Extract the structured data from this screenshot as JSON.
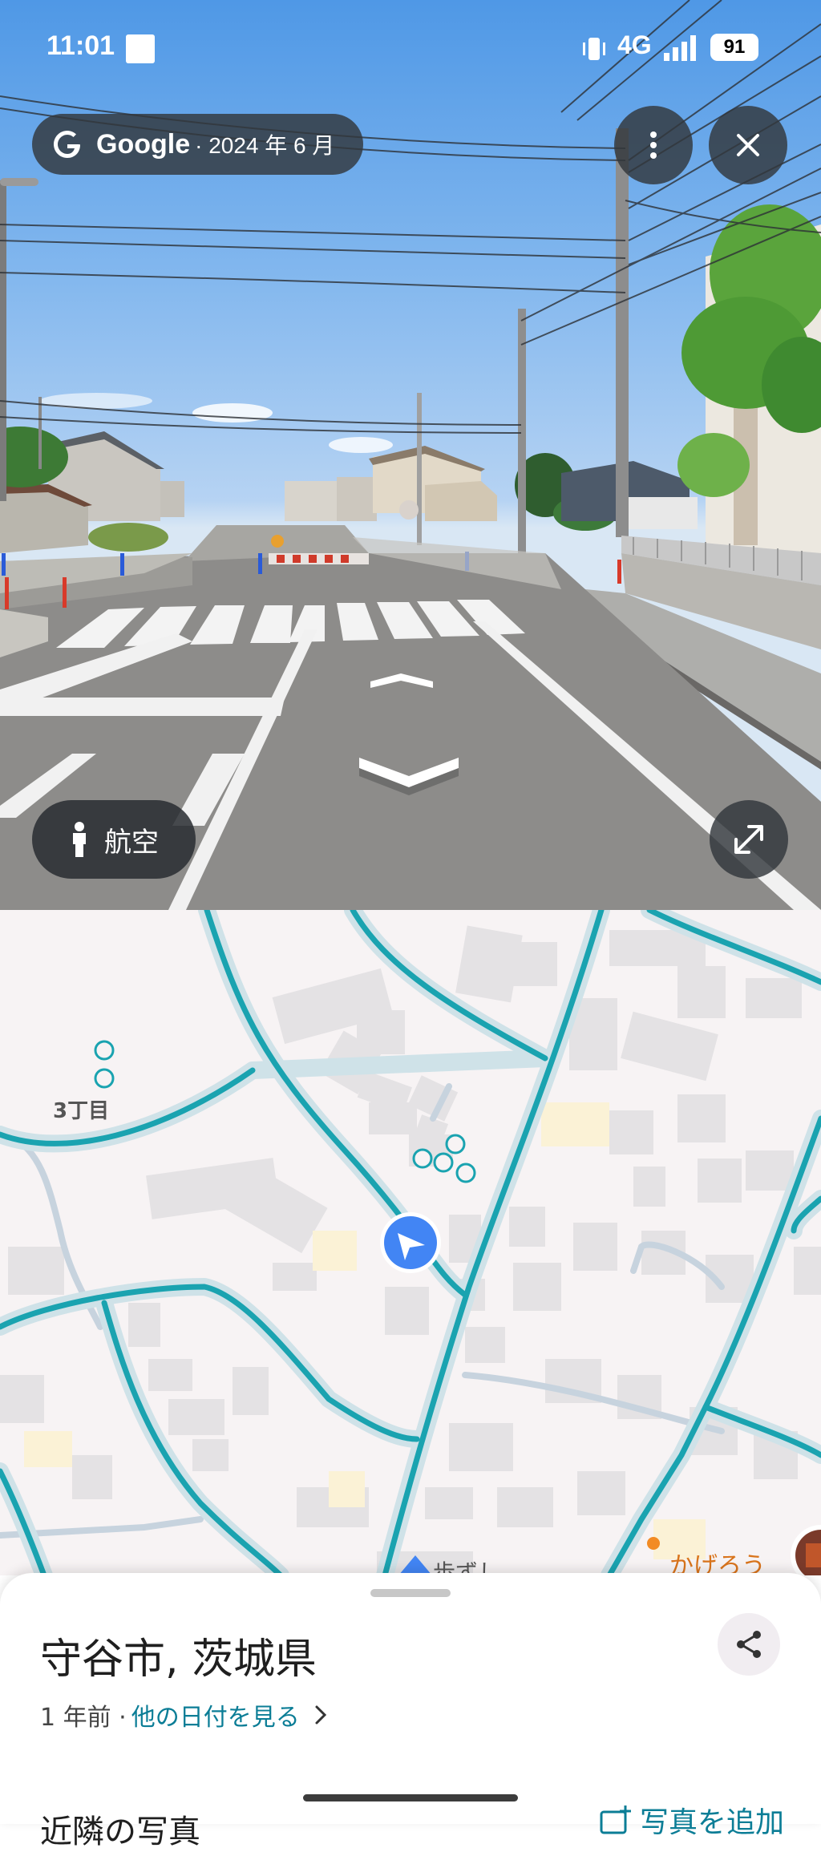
{
  "status_bar": {
    "time": "11:01",
    "network": "4G",
    "battery": "91"
  },
  "street_view": {
    "brand": "Google",
    "capture_date": "· 2024 年 6 月",
    "aerial_button": "航空",
    "menu_icon": "more-vert-icon",
    "close_icon": "close-icon",
    "expand_icon": "expand-icon"
  },
  "map": {
    "labels": [
      "3丁目",
      "歩ずし",
      "かげろう"
    ],
    "road_color": "#1aa3b0",
    "location_arrow_color": "#4285f4"
  },
  "sheet": {
    "place_title": "守谷市, 茨城県",
    "age": "1 年前 ·",
    "other_dates": "他の日付を見る",
    "nearby_title": "近隣の写真",
    "add_photo": "写真を追加"
  },
  "colors": {
    "accent": "#0b7d96"
  }
}
